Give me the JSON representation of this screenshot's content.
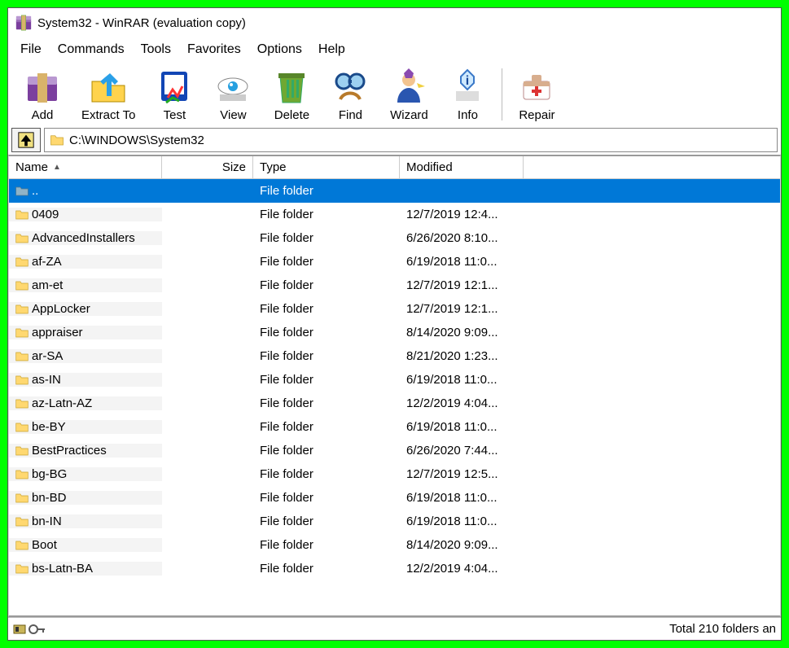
{
  "title": "System32 - WinRAR (evaluation copy)",
  "menus": [
    "File",
    "Commands",
    "Tools",
    "Favorites",
    "Options",
    "Help"
  ],
  "toolbar": [
    {
      "label": "Add",
      "icon": "add"
    },
    {
      "label": "Extract To",
      "icon": "extract"
    },
    {
      "label": "Test",
      "icon": "test"
    },
    {
      "label": "View",
      "icon": "view"
    },
    {
      "label": "Delete",
      "icon": "delete"
    },
    {
      "label": "Find",
      "icon": "find"
    },
    {
      "label": "Wizard",
      "icon": "wizard"
    },
    {
      "label": "Info",
      "icon": "info"
    },
    {
      "sep": true
    },
    {
      "label": "Repair",
      "icon": "repair"
    }
  ],
  "path": "C:\\WINDOWS\\System32",
  "columns": {
    "name": "Name",
    "size": "Size",
    "type": "Type",
    "modified": "Modified"
  },
  "files": [
    {
      "name": "..",
      "size": "",
      "type": "File folder",
      "modified": "",
      "selected": true,
      "icon": "parent"
    },
    {
      "name": "0409",
      "size": "",
      "type": "File folder",
      "modified": "12/7/2019 12:4..."
    },
    {
      "name": "AdvancedInstallers",
      "size": "",
      "type": "File folder",
      "modified": "6/26/2020 8:10..."
    },
    {
      "name": "af-ZA",
      "size": "",
      "type": "File folder",
      "modified": "6/19/2018 11:0..."
    },
    {
      "name": "am-et",
      "size": "",
      "type": "File folder",
      "modified": "12/7/2019 12:1..."
    },
    {
      "name": "AppLocker",
      "size": "",
      "type": "File folder",
      "modified": "12/7/2019 12:1..."
    },
    {
      "name": "appraiser",
      "size": "",
      "type": "File folder",
      "modified": "8/14/2020 9:09..."
    },
    {
      "name": "ar-SA",
      "size": "",
      "type": "File folder",
      "modified": "8/21/2020 1:23..."
    },
    {
      "name": "as-IN",
      "size": "",
      "type": "File folder",
      "modified": "6/19/2018 11:0..."
    },
    {
      "name": "az-Latn-AZ",
      "size": "",
      "type": "File folder",
      "modified": "12/2/2019 4:04..."
    },
    {
      "name": "be-BY",
      "size": "",
      "type": "File folder",
      "modified": "6/19/2018 11:0..."
    },
    {
      "name": "BestPractices",
      "size": "",
      "type": "File folder",
      "modified": "6/26/2020 7:44..."
    },
    {
      "name": "bg-BG",
      "size": "",
      "type": "File folder",
      "modified": "12/7/2019 12:5..."
    },
    {
      "name": "bn-BD",
      "size": "",
      "type": "File folder",
      "modified": "6/19/2018 11:0..."
    },
    {
      "name": "bn-IN",
      "size": "",
      "type": "File folder",
      "modified": "6/19/2018 11:0..."
    },
    {
      "name": "Boot",
      "size": "",
      "type": "File folder",
      "modified": "8/14/2020 9:09..."
    },
    {
      "name": "bs-Latn-BA",
      "size": "",
      "type": "File folder",
      "modified": "12/2/2019 4:04..."
    }
  ],
  "status_right": "Total 210 folders an",
  "sort_column": "name",
  "sort_dir": "asc"
}
